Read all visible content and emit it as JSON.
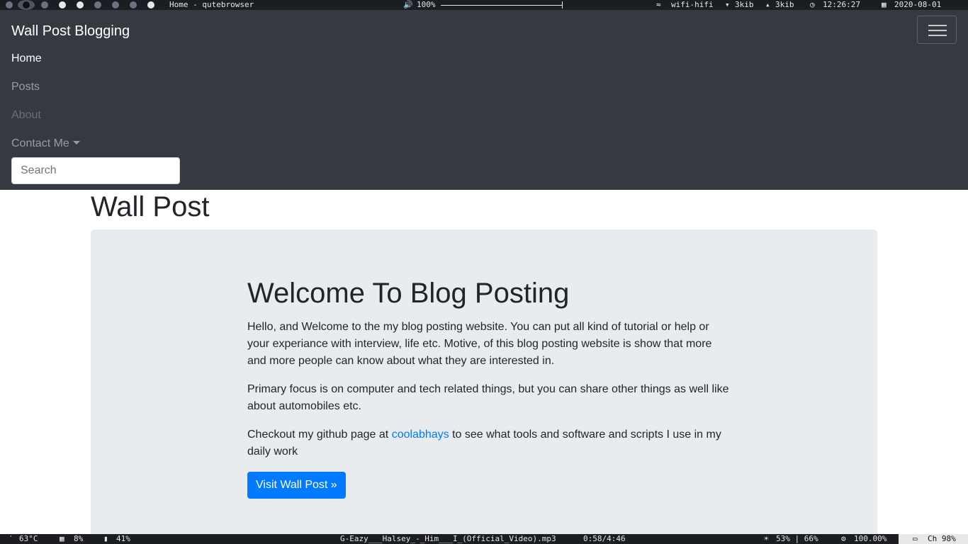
{
  "system_top": {
    "window_title": "Home - qutebrowser",
    "volume_icon": "speaker-icon",
    "volume": "100%",
    "volume_bar_fraction": 1.0,
    "wifi_icon": "wifi-icon",
    "wifi_name": "wifi-hifi",
    "down_icon": "arrow-down-icon",
    "download": "3kib",
    "up_icon": "arrow-up-icon",
    "upload": "3kib",
    "clock_icon": "clock-icon",
    "time": "12:26:27",
    "calendar_icon": "calendar-icon",
    "date": "2020-08-01"
  },
  "navbar": {
    "brand": "Wall Post Blogging",
    "toggler_icon": "hamburger-icon",
    "links": {
      "home": "Home",
      "posts": "Posts",
      "about": "About",
      "contact": "Contact Me"
    },
    "search": {
      "placeholder": "Search",
      "value": ""
    }
  },
  "main": {
    "title": "Wall Post",
    "jumbotron": {
      "heading": "Welcome To Blog Posting",
      "p1": "Hello, and Welcome to the my blog posting website. You can put all kind of tutorial or help or your experiance with interview, life etc. Motive, of this blog posting website is show that more and more people can know about what they are interested in.",
      "p2": "Primary focus is on computer and tech related things, but you can share other things as well like about automobiles etc.",
      "p3_before": "Checkout my github page at ",
      "p3_link": "coolabhays",
      "p3_after": " to see what tools and software and scripts I use in my daily work",
      "button": "Visit Wall Post »"
    }
  },
  "system_bottom": {
    "temp_icon": "thermometer-icon",
    "temp": "63°C",
    "cpu_icon": "cpu-icon",
    "cpu": "8%",
    "mem_icon": "memory-icon",
    "mem": "41%",
    "media": "G-Eazy___Halsey_-_Him___I_(Official_Video).mp3",
    "media_time": "0:58/4:46",
    "brightness_icon": "brightness-icon",
    "brightness": "53% | 66%",
    "gear_icon": "gear-icon",
    "volume2": "100.00%",
    "battery_icon": "battery-icon",
    "battery": "Ch 98%"
  },
  "colors": {
    "navbar_bg": "#343a40",
    "jumbotron_bg": "#e9ecef",
    "primary": "#007bff"
  }
}
